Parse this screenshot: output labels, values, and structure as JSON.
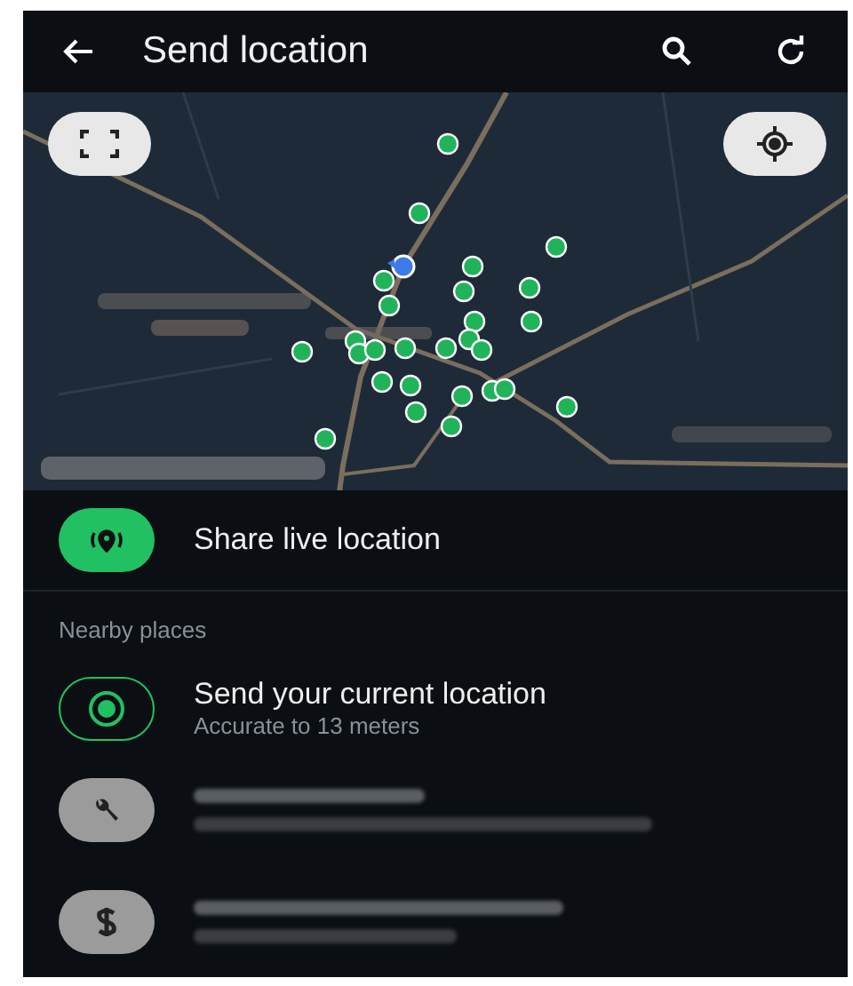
{
  "header": {
    "title": "Send location"
  },
  "share_live": {
    "label": "Share live location"
  },
  "nearby": {
    "heading": "Nearby places",
    "current": {
      "title": "Send your current location",
      "subtitle": "Accurate to 13 meters"
    }
  }
}
